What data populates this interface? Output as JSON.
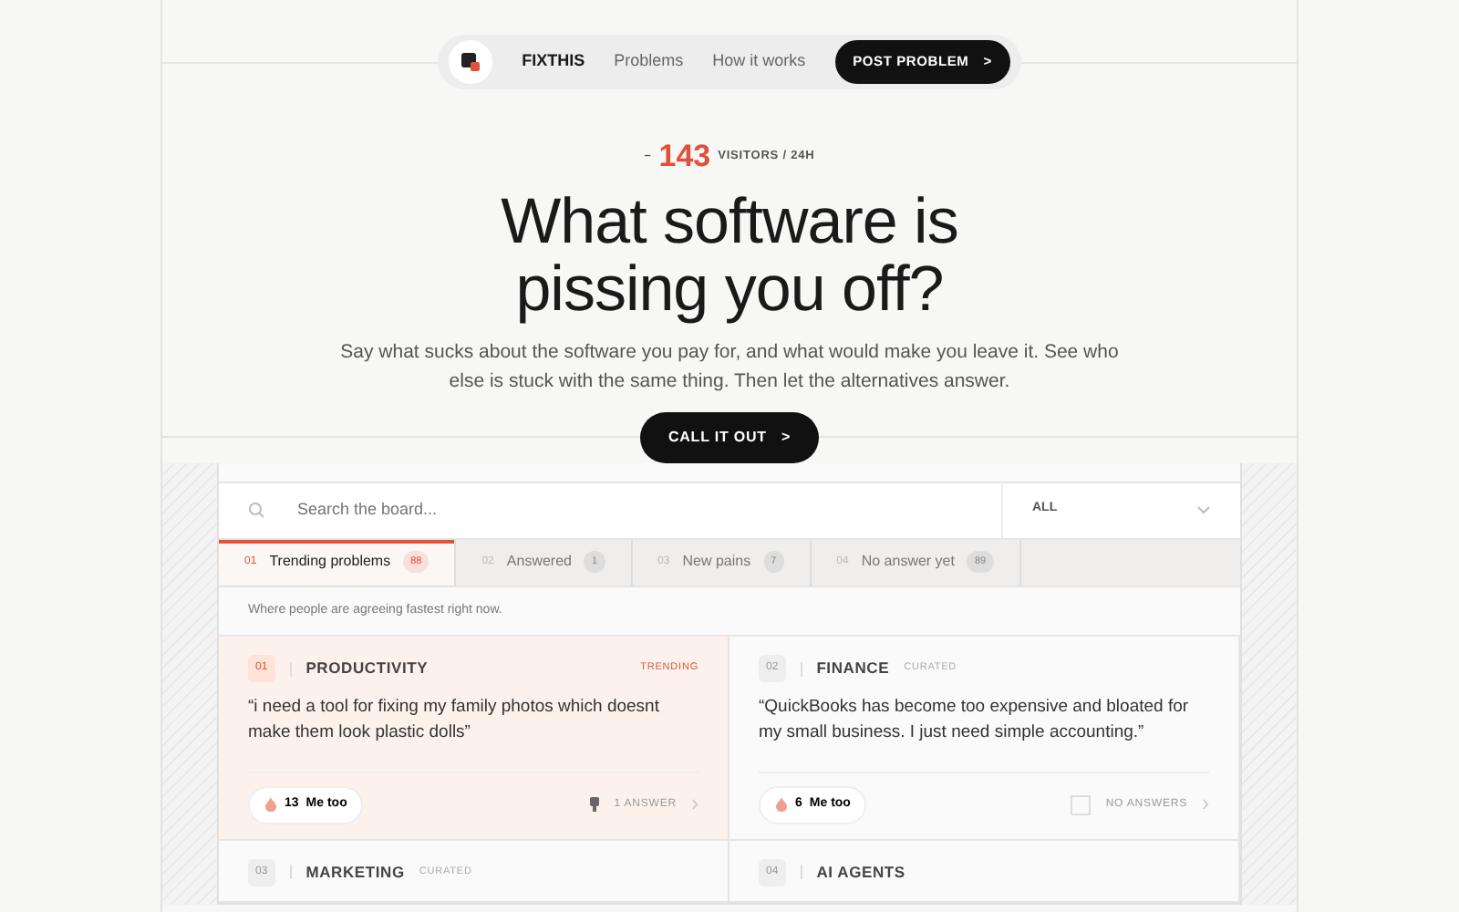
{
  "nav": {
    "brand": "FIXTHIS",
    "links": [
      "Problems",
      "How it works"
    ],
    "cta": "POST PROBLEM",
    "cta_arrow": ">"
  },
  "hero": {
    "dash": "–",
    "visitors": "143",
    "visitors_label": "VISITORS / 24H",
    "title": "What software is pissing you off?",
    "subtitle": "Say what sucks about the software you pay for, and what would make you leave it. See who else is stuck with the same thing. Then let the alternatives answer.",
    "cta": "CALL IT OUT",
    "cta_arrow": ">"
  },
  "board": {
    "search": {
      "placeholder": "Search the board..."
    },
    "filter": {
      "value": "ALL"
    },
    "tabs": [
      {
        "num": "01",
        "label": "Trending problems",
        "count": "88",
        "selected": true
      },
      {
        "num": "02",
        "label": "Answered",
        "count": "1",
        "selected": false
      },
      {
        "num": "03",
        "label": "New pains",
        "count": "7",
        "selected": false
      },
      {
        "num": "04",
        "label": "No answer yet",
        "count": "89",
        "selected": false
      }
    ],
    "hint": "Where people are agreeing fastest right now.",
    "cards": [
      {
        "num": "01",
        "category": "PRODUCTIVITY",
        "tag": "TRENDING",
        "kind": "trending",
        "quote": "“i need a tool for fixing my family photos which doesnt make them look plastic dolls”",
        "votes": "13",
        "vote_label": "Me too",
        "answers": "1 ANSWER",
        "answered": true
      },
      {
        "num": "02",
        "category": "FINANCE",
        "tag": "CURATED",
        "kind": "curated",
        "quote": "“QuickBooks has become too expensive and bloated for my small business. I just need simple accounting.”",
        "votes": "6",
        "vote_label": "Me too",
        "answers": "NO ANSWERS",
        "answered": false
      },
      {
        "num": "03",
        "category": "MARKETING",
        "tag": "CURATED",
        "kind": "curated"
      },
      {
        "num": "04",
        "category": "AI AGENTS",
        "kind": "plain"
      }
    ]
  }
}
